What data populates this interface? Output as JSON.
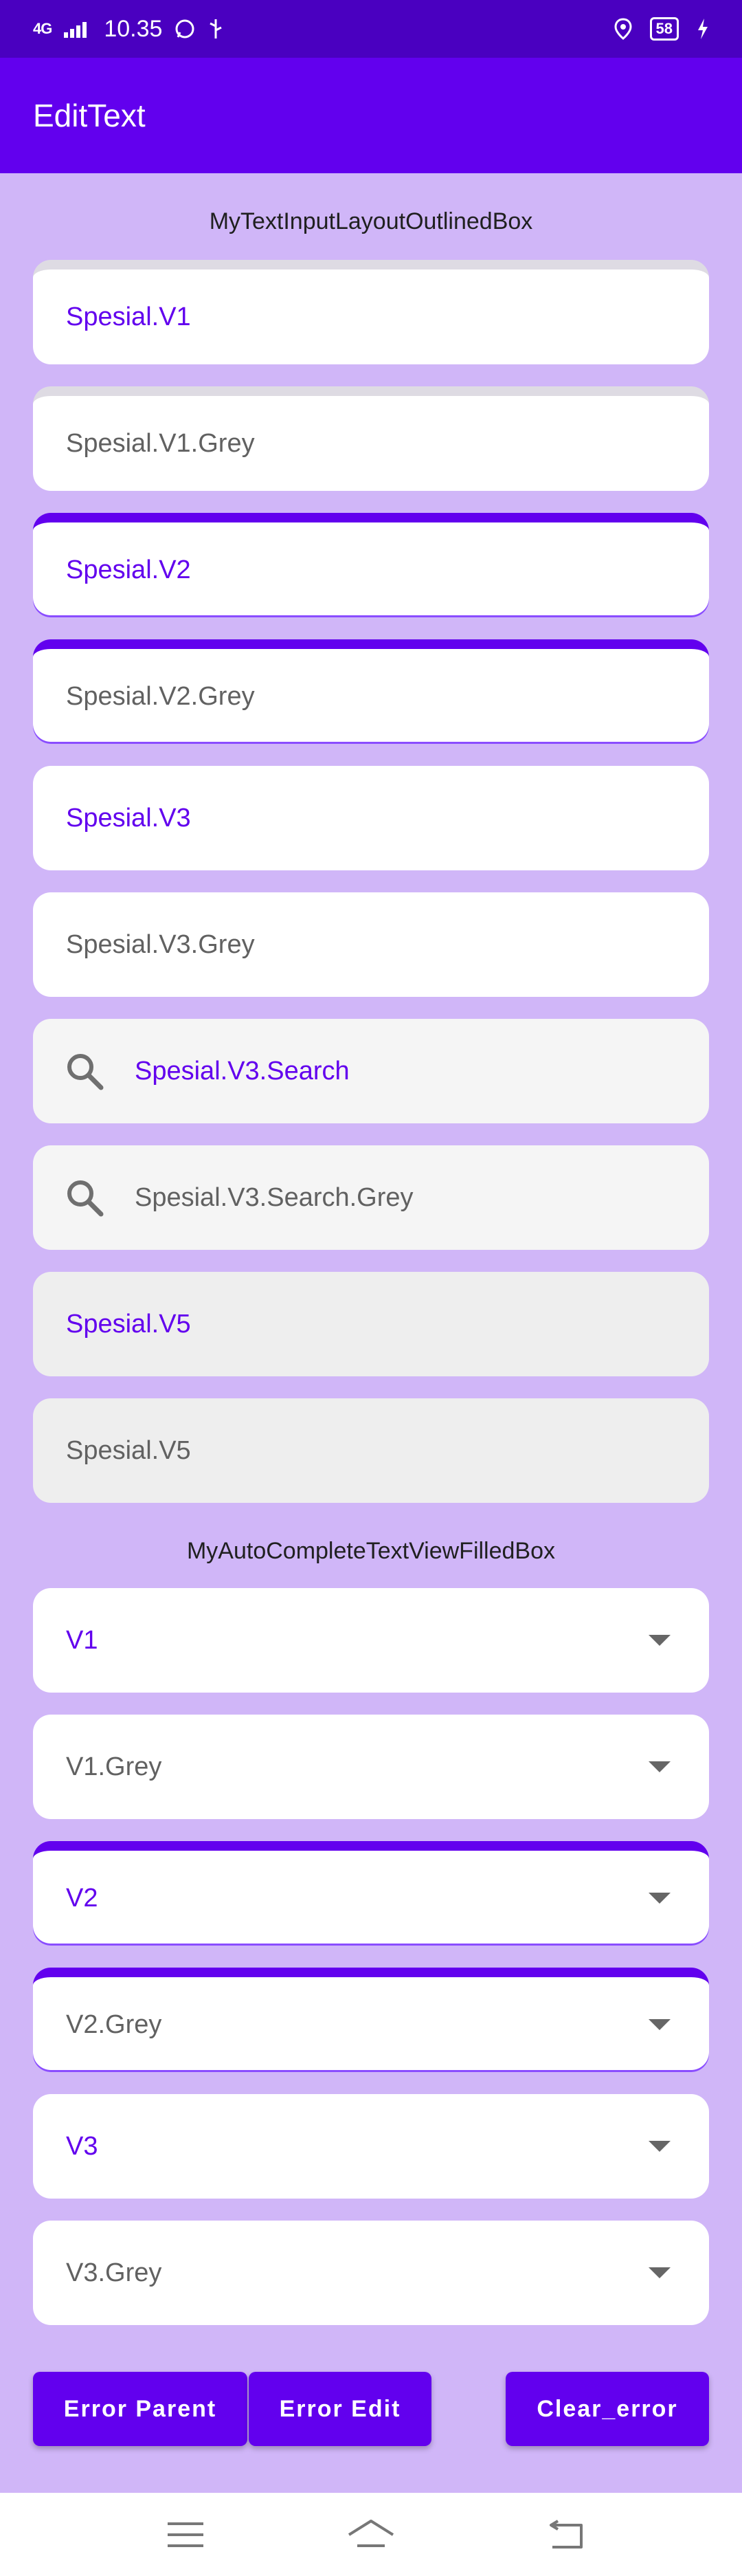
{
  "status_bar": {
    "network": "4G",
    "time": "10.35",
    "battery": "58"
  },
  "app_bar": {
    "title": "EditText"
  },
  "section1": {
    "label": "MyTextInputLayoutOutlinedBox",
    "fields": [
      "Spesial.V1",
      "Spesial.V1.Grey",
      "Spesial.V2",
      "Spesial.V2.Grey",
      "Spesial.V3",
      "Spesial.V3.Grey",
      "Spesial.V3.Search",
      "Spesial.V3.Search.Grey",
      "Spesial.V5",
      "Spesial.V5"
    ]
  },
  "section2": {
    "label": "MyAutoCompleteTextViewFilledBox",
    "fields": [
      "V1",
      "V1.Grey",
      "V2",
      "V2.Grey",
      "V3",
      "V3.Grey"
    ]
  },
  "buttons": {
    "error_parent": "Error Parent",
    "error_edit": "Error Edit",
    "clear_error": "Clear_error"
  },
  "colors": {
    "primary": "#6200ee",
    "status_bar": "#4a00c0",
    "background": "#d0b6f8"
  },
  "icons": [
    "whatsapp-icon",
    "usb-icon",
    "location-icon",
    "charging-icon",
    "search-icon",
    "dropdown-arrow-icon",
    "menu-icon",
    "home-icon",
    "back-icon"
  ]
}
